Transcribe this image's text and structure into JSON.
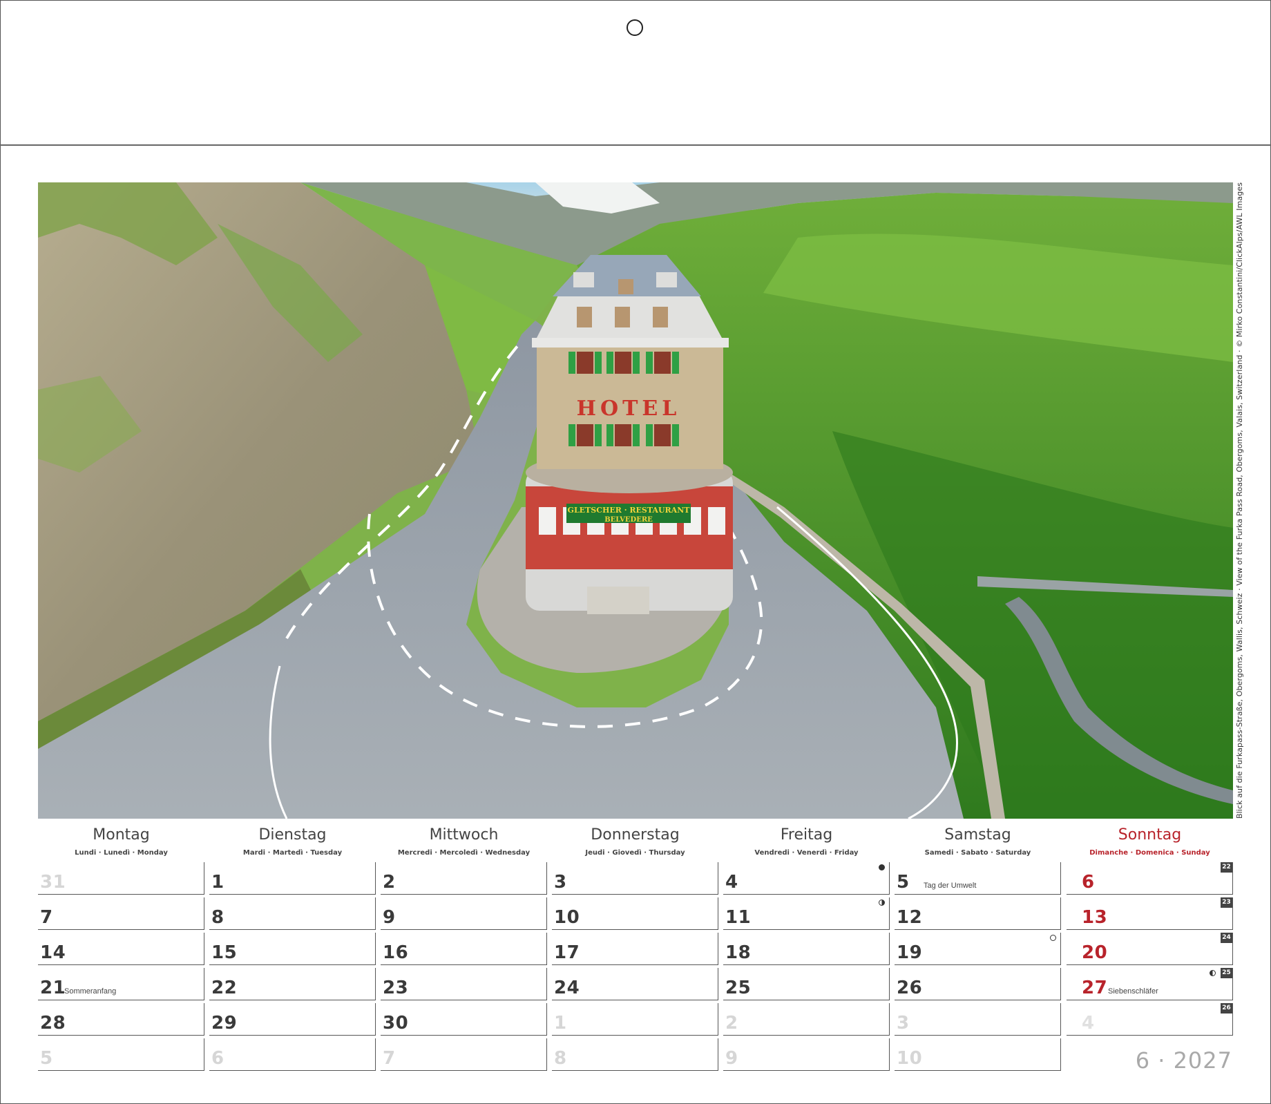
{
  "photo": {
    "hotel_sign": "HOTEL",
    "restaurant_sign_line1": "GLETSCHER · RESTAURANT",
    "restaurant_sign_line2": "BELVEDERE",
    "credit": "Blick auf die Furkapass-Straße, Obergoms, Wallis, Schweiz · View of the Furka Pass Road, Obergoms, Valais, Switzerland · © Mirko Constantini/ClickAlps/AWL Images"
  },
  "weekdays": [
    {
      "name": "Montag",
      "sub": "Lundi · Lunedì · Monday"
    },
    {
      "name": "Dienstag",
      "sub": "Mardi · Martedì · Tuesday"
    },
    {
      "name": "Mittwoch",
      "sub": "Mercredi · Mercoledì · Wednesday"
    },
    {
      "name": "Donnerstag",
      "sub": "Jeudi · Giovedì · Thursday"
    },
    {
      "name": "Freitag",
      "sub": "Vendredi · Venerdì · Friday"
    },
    {
      "name": "Samstag",
      "sub": "Samedi · Sabato · Saturday"
    },
    {
      "name": "Sonntag",
      "sub": "Dimanche · Domenica · Sunday"
    }
  ],
  "weeks": [
    {
      "kw": "22",
      "days": [
        "31",
        "1",
        "2",
        "3",
        "4",
        "5",
        "6"
      ]
    },
    {
      "kw": "23",
      "days": [
        "7",
        "8",
        "9",
        "10",
        "11",
        "12",
        "13"
      ]
    },
    {
      "kw": "24",
      "days": [
        "14",
        "15",
        "16",
        "17",
        "18",
        "19",
        "20"
      ]
    },
    {
      "kw": "25",
      "days": [
        "21",
        "22",
        "23",
        "24",
        "25",
        "26",
        "27"
      ]
    },
    {
      "kw": "26",
      "days": [
        "28",
        "29",
        "30",
        "1",
        "2",
        "3",
        "4"
      ]
    },
    {
      "kw": "",
      "days": [
        "5",
        "6",
        "7",
        "8",
        "9",
        "10",
        ""
      ]
    }
  ],
  "notes": {
    "tag_der_umwelt": "Tag der Umwelt",
    "sommeranfang": "Sommeranfang",
    "siebenschlaefer": "Siebenschläfer"
  },
  "colors": {
    "sunday": "#b8232b",
    "outside_day": "#d6d6d6",
    "text": "#3a3a3a"
  },
  "footer": {
    "month_year": "6 · 2027"
  }
}
